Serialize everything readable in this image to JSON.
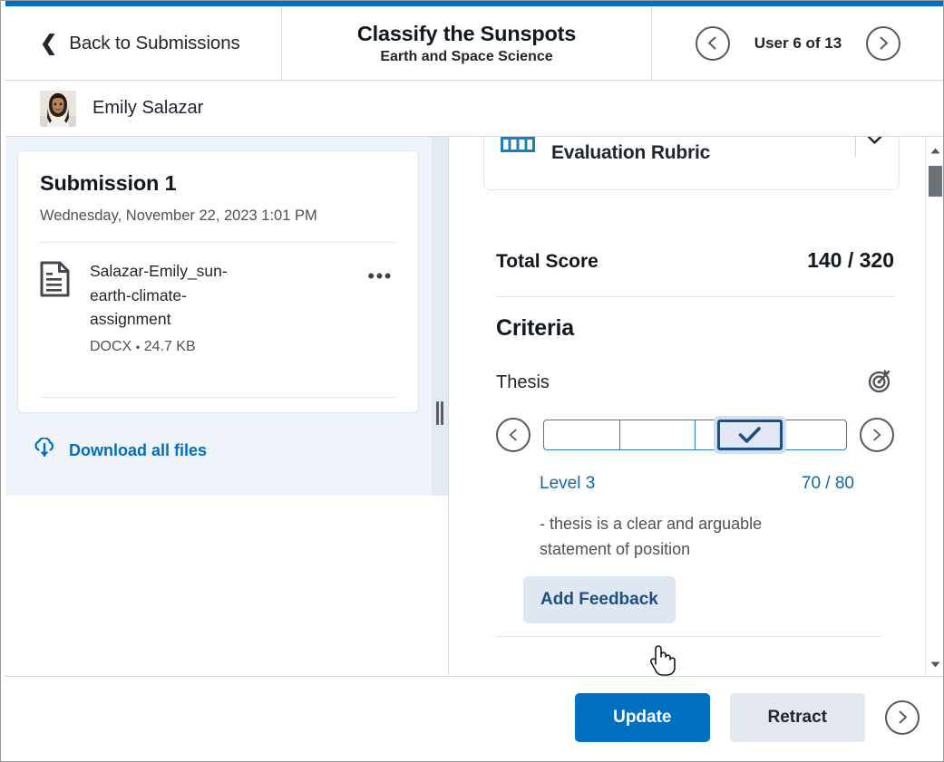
{
  "header": {
    "back_label": "Back to Submissions",
    "back_icon": "chevron-left-icon",
    "title": "Classify the Sunspots",
    "subtitle": "Earth and Space Science",
    "pager_label": "User 6 of 13",
    "prev_icon": "circle-chevron-left-icon",
    "next_icon": "circle-chevron-right-icon"
  },
  "user": {
    "name": "Emily Salazar",
    "avatar_icon": "user-avatar-photo"
  },
  "submissions": {
    "card": {
      "title": "Submission 1",
      "date": "Wednesday, November 22, 2023 1:01 PM",
      "file": {
        "icon": "document-icon",
        "name": "Salazar-Emily_sun-earth-climate-assignment",
        "type": "DOCX",
        "separator": "•",
        "size": "24.7 KB",
        "menu_icon": "more-options-icon",
        "menu_label": "•••"
      }
    },
    "download_all": {
      "label": "Download all files",
      "icon": "cloud-download-icon"
    }
  },
  "rubric": {
    "icon": "rubric-grid-icon",
    "name": "Evaluation Rubric",
    "collapse_icon": "chevron-down-icon",
    "total_label": "Total Score",
    "total_value": "140 / 320",
    "criteria_heading": "Criteria",
    "criteria": [
      {
        "name": "Thesis",
        "outcome_icon": "learning-outcome-target-icon",
        "prev_icon": "circle-chevron-left-icon",
        "next_icon": "circle-chevron-right-icon",
        "levels_count": 4,
        "selected_index": 2,
        "selected_check_icon": "check-icon",
        "level_name": "Level 3",
        "level_score": "70 / 80",
        "level_description": "- thesis is a clear and arguable statement of position",
        "feedback_button": "Add Feedback"
      }
    ]
  },
  "scrollbar": {
    "up_icon": "scroll-up-arrow-icon",
    "down_icon": "scroll-down-arrow-icon",
    "thumb_icon": "scrollbar-thumb"
  },
  "splitter": {
    "grip_icon": "panel-resize-grip-icon"
  },
  "footer": {
    "update_label": "Update",
    "retract_label": "Retract",
    "next_icon": "circle-chevron-right-icon"
  },
  "colors": {
    "accent": "#006fbf",
    "link": "#006fbf",
    "level_text": "#1667a8",
    "selected_border": "#1f4e87",
    "panel_bg": "#eff3fa"
  }
}
